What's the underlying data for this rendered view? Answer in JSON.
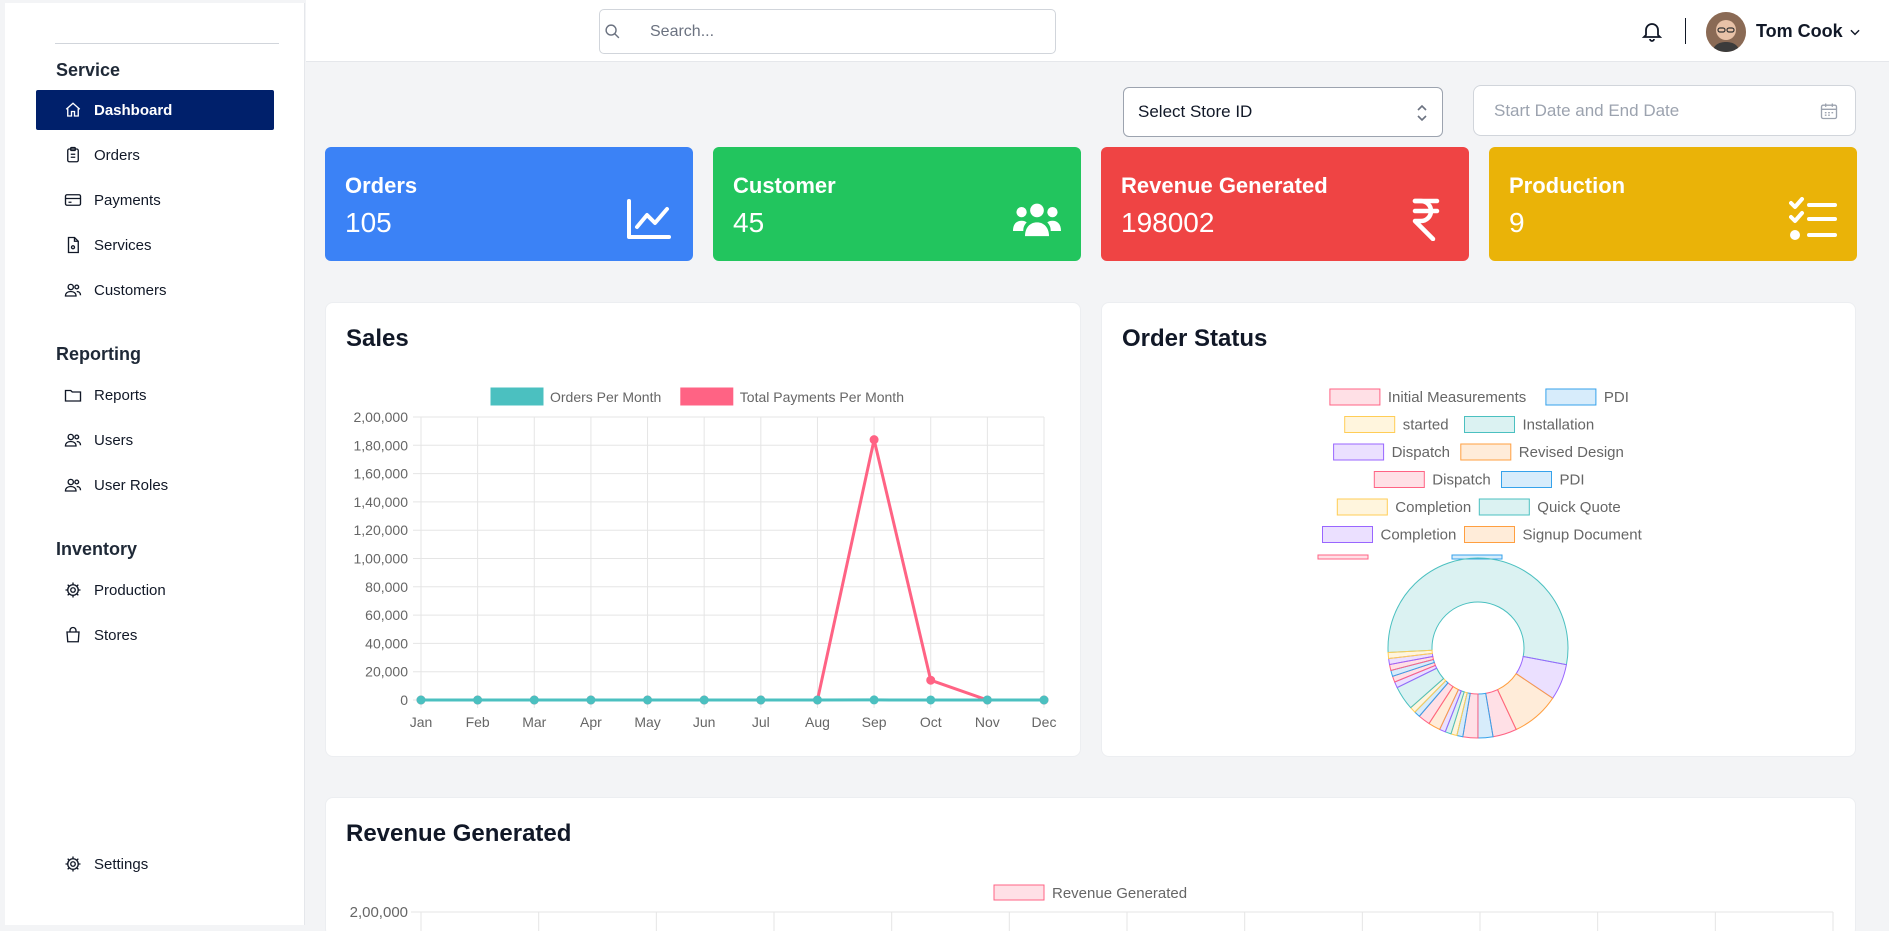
{
  "header": {
    "search_placeholder": "Search...",
    "user_name": "Tom Cook"
  },
  "sidebar": {
    "sections": [
      {
        "title": "Service",
        "items": [
          {
            "label": "Dashboard",
            "icon": "home-icon",
            "active": true
          },
          {
            "label": "Orders",
            "icon": "clipboard-icon"
          },
          {
            "label": "Payments",
            "icon": "credit-card-icon"
          },
          {
            "label": "Services",
            "icon": "document-icon"
          },
          {
            "label": "Customers",
            "icon": "users-icon"
          }
        ]
      },
      {
        "title": "Reporting",
        "items": [
          {
            "label": "Reports",
            "icon": "folder-icon"
          },
          {
            "label": "Users",
            "icon": "users-icon"
          },
          {
            "label": "User Roles",
            "icon": "users-icon"
          }
        ]
      },
      {
        "title": "Inventory",
        "items": [
          {
            "label": "Production",
            "icon": "gear-icon"
          },
          {
            "label": "Stores",
            "icon": "shopping-bag-icon"
          }
        ]
      }
    ],
    "settings_label": "Settings"
  },
  "filters": {
    "store_select_value": "Select Store ID",
    "date_placeholder": "Start Date and End Date"
  },
  "stats": [
    {
      "label": "Orders",
      "value": "105",
      "color": "#3b82f6",
      "icon": "chart-line-icon"
    },
    {
      "label": "Customer",
      "value": "45",
      "color": "#22c55e",
      "icon": "users-group-icon"
    },
    {
      "label": "Revenue Generated",
      "value": "198002",
      "color": "#ef4444",
      "icon": "rupee-icon"
    },
    {
      "label": "Production",
      "value": "9",
      "color": "#eab308",
      "icon": "checklist-icon"
    }
  ],
  "sales": {
    "title": "Sales",
    "chart_data": {
      "type": "line",
      "categories": [
        "Jan",
        "Feb",
        "Mar",
        "Apr",
        "May",
        "Jun",
        "Jul",
        "Aug",
        "Sep",
        "Oct",
        "Nov",
        "Dec"
      ],
      "series": [
        {
          "name": "Orders Per Month",
          "color": "#4bc0c0",
          "values": [
            0,
            0,
            0,
            0,
            0,
            0,
            0,
            0,
            45,
            40,
            20,
            0
          ]
        },
        {
          "name": "Total Payments Per Month",
          "color": "#ff6384",
          "values": [
            0,
            0,
            0,
            0,
            0,
            0,
            0,
            0,
            184000,
            14000,
            0,
            0
          ]
        }
      ],
      "ylim": [
        0,
        200000
      ],
      "yticks": [
        "2,00,000",
        "1,80,000",
        "1,60,000",
        "1,40,000",
        "1,20,000",
        "1,00,000",
        "80,000",
        "60,000",
        "40,000",
        "20,000",
        "0"
      ],
      "grid": true,
      "legend": "top"
    }
  },
  "order_status": {
    "title": "Order Status",
    "chart_data": {
      "type": "pie",
      "legend_items": [
        {
          "label": "Initial Measurements",
          "color": "#ff6384"
        },
        {
          "label": "PDI",
          "color": "#36a2eb"
        },
        {
          "label": "started",
          "color": "#ffcd56"
        },
        {
          "label": "Installation",
          "color": "#4bc0c0"
        },
        {
          "label": "Dispatch",
          "color": "#9966ff"
        },
        {
          "label": "Revised Design",
          "color": "#ff9f40"
        },
        {
          "label": "Dispatch",
          "color": "#ff6384"
        },
        {
          "label": "PDI",
          "color": "#36a2eb"
        },
        {
          "label": "Completion",
          "color": "#ffcd56"
        },
        {
          "label": "Quick Quote",
          "color": "#4bc0c0"
        },
        {
          "label": "Completion",
          "color": "#9966ff"
        },
        {
          "label": "Signup Document",
          "color": "#ff9f40"
        }
      ],
      "slices": [
        {
          "color": "#4bc0c0",
          "value": 50
        },
        {
          "color": "#9966ff",
          "value": 6
        },
        {
          "color": "#ff9f40",
          "value": 8
        },
        {
          "color": "#ff6384",
          "value": 4
        },
        {
          "color": "#36a2eb",
          "value": 2.5
        },
        {
          "color": "#ff6384",
          "value": 2.5
        },
        {
          "color": "#36a2eb",
          "value": 1
        },
        {
          "color": "#ffcd56",
          "value": 1
        },
        {
          "color": "#4bc0c0",
          "value": 1
        },
        {
          "color": "#9966ff",
          "value": 1
        },
        {
          "color": "#ff9f40",
          "value": 2
        },
        {
          "color": "#ff6384",
          "value": 2
        },
        {
          "color": "#36a2eb",
          "value": 1
        },
        {
          "color": "#ffcd56",
          "value": 1
        },
        {
          "color": "#4bc0c0",
          "value": 4
        },
        {
          "color": "#9966ff",
          "value": 1
        },
        {
          "color": "#ff6384",
          "value": 1
        },
        {
          "color": "#36a2eb",
          "value": 1
        },
        {
          "color": "#ff6384",
          "value": 1
        },
        {
          "color": "#9966ff",
          "value": 1
        },
        {
          "color": "#ffcd56",
          "value": 1
        }
      ]
    }
  },
  "revenue": {
    "title": "Revenue Generated",
    "chart_data": {
      "type": "bar",
      "series": [
        {
          "name": "Revenue Generated",
          "color": "#ff6384"
        }
      ],
      "yticks": [
        "2,00,000"
      ]
    }
  }
}
